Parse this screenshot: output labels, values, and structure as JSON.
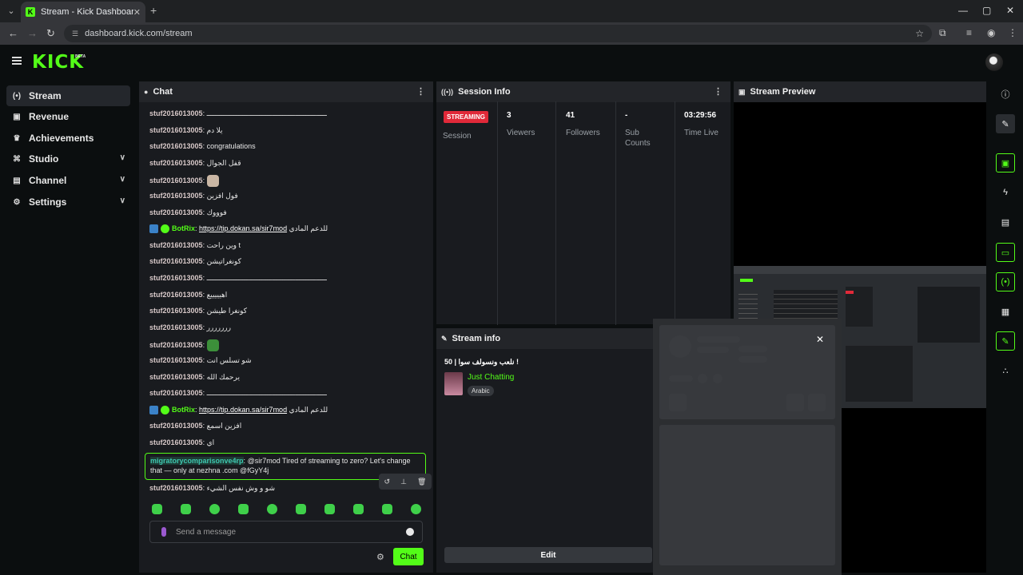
{
  "browser": {
    "tab_title": "Stream - Kick Dashboard",
    "tab_icon": "K",
    "url": "dashboard.kick.com/stream"
  },
  "header": {
    "logo": "KICK",
    "beta": "BETA"
  },
  "sidebar": {
    "items": [
      {
        "icon": "stream-icon",
        "label": "Stream",
        "active": true
      },
      {
        "icon": "revenue-icon",
        "label": "Revenue"
      },
      {
        "icon": "trophy-icon",
        "label": "Achievements"
      },
      {
        "icon": "studio-icon",
        "label": "Studio",
        "expandable": true
      },
      {
        "icon": "channel-icon",
        "label": "Channel",
        "expandable": true
      },
      {
        "icon": "gear-icon",
        "label": "Settings",
        "expandable": true
      }
    ]
  },
  "chat": {
    "title": "Chat",
    "messages": [
      {
        "user": "stuf2016013005",
        "text": "ـــــــــــــــــــــــــــــــــــــــــــــــــــــــــ"
      },
      {
        "user": "stuf2016013005",
        "text": "يلا دم"
      },
      {
        "user": "stuf2016013005",
        "text": "congratulations"
      },
      {
        "user": "stuf2016013005",
        "text": "قفل الجوال"
      },
      {
        "user": "stuf2016013005",
        "text": "",
        "emote": "cat"
      },
      {
        "user": "stuf2016013005",
        "text": "فول افزين"
      },
      {
        "user": "stuf2016013005",
        "text": "فوووك"
      },
      {
        "user": "BotRix",
        "bot": true,
        "link": "https://tip.dokan.sa/sir7mod",
        "text": "للدعم المادي"
      },
      {
        "user": "stuf2016013005",
        "text": "وين راحت t"
      },
      {
        "user": "stuf2016013005",
        "text": "كونغراتيشن"
      },
      {
        "user": "stuf2016013005",
        "text": "ـــــــــــــــــــــــــــــــــــــــــــــــــــــــــ"
      },
      {
        "user": "stuf2016013005",
        "text": "اهيييييع"
      },
      {
        "user": "stuf2016013005",
        "text": "كونغرا طيشن"
      },
      {
        "user": "stuf2016013005",
        "text": "ررررررر"
      },
      {
        "user": "stuf2016013005",
        "text": "",
        "emote": "frog"
      },
      {
        "user": "stuf2016013005",
        "text": "شو تسلس انت"
      },
      {
        "user": "stuf2016013005",
        "text": "يرحمك الله"
      },
      {
        "user": "stuf2016013005",
        "text": "ـــــــــــــــــــــــــــــــــــــــــــــــــــــــــ"
      },
      {
        "user": "BotRix",
        "bot": true,
        "link": "https://tip.dokan.sa/sir7mod",
        "text": "للدعم المادي"
      },
      {
        "user": "stuf2016013005",
        "text": "افزين اسمع"
      },
      {
        "user": "stuf2016013005",
        "text": "اي"
      }
    ],
    "highlight": {
      "user": "migratorycomparisonve4rp",
      "text": "@sir7mod Tired of streaming to zero? Let's change that — only at nezhna .com @fGyY4j"
    },
    "last_message": {
      "user": "stuf2016013005",
      "text": "شو و وش نفس الشيء"
    },
    "input_placeholder": "Send a message",
    "send_label": "Chat"
  },
  "session": {
    "title": "Session Info",
    "status": "STREAMING",
    "session_label": "Session",
    "stats": [
      {
        "value": "3",
        "label": "Viewers"
      },
      {
        "value": "41",
        "label": "Followers"
      },
      {
        "value": "-",
        "label": "Sub Counts"
      },
      {
        "value": "03:29:56",
        "label": "Time Live"
      }
    ]
  },
  "stream_info": {
    "title": "Stream info",
    "stream_title": "نلعب ونسولف سوا | 50 !",
    "category": "Just Chatting",
    "language": "Arabic",
    "edit_label": "Edit"
  },
  "preview": {
    "title": "Stream Preview"
  },
  "colors": {
    "accent": "#53fc18",
    "live": "#e02939",
    "panel": "#191b1f"
  }
}
